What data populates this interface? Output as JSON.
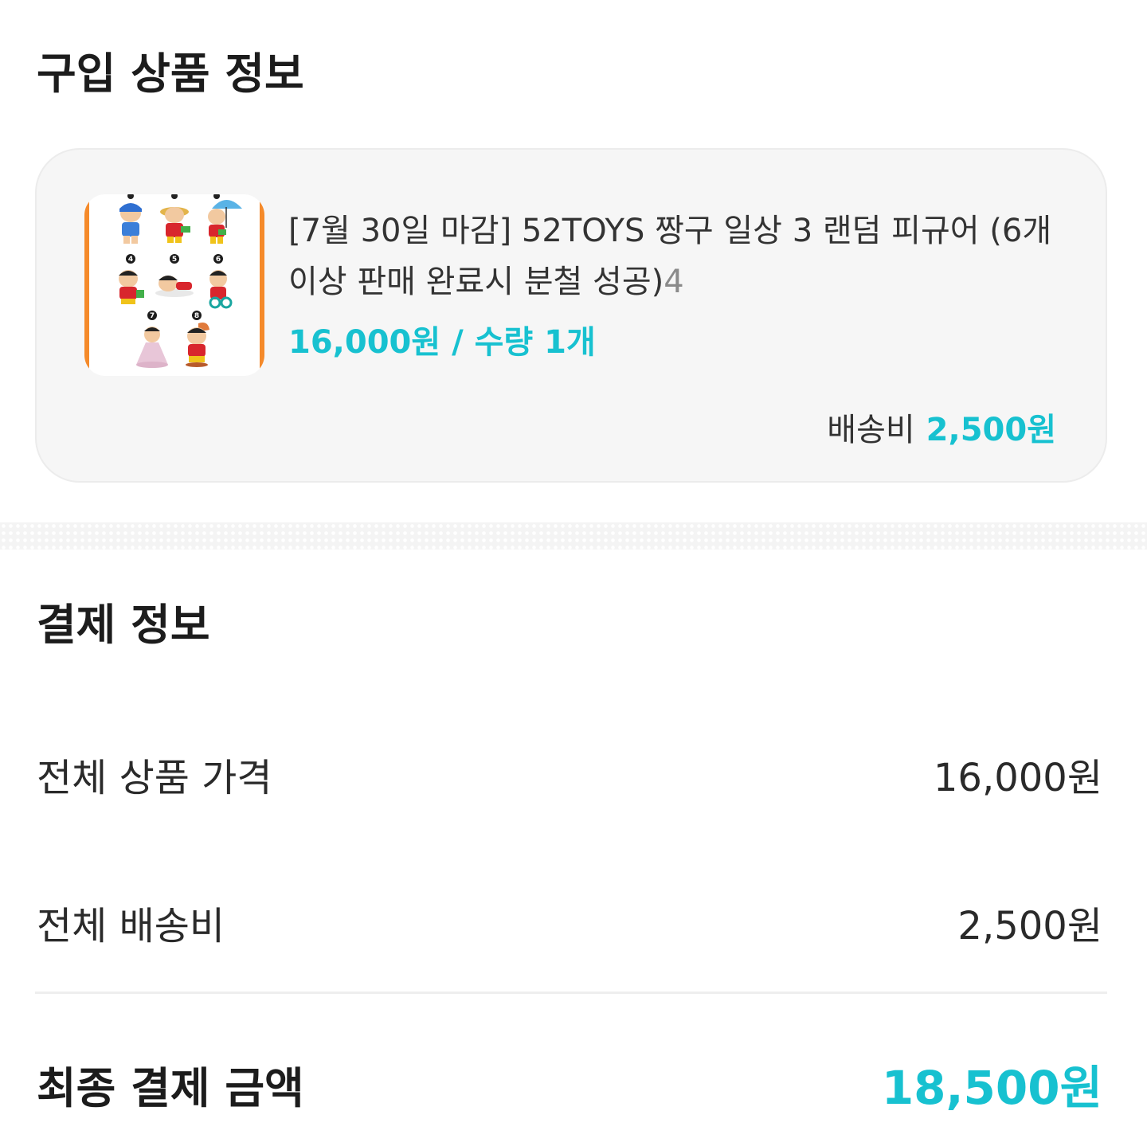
{
  "purchase_section": {
    "title": "구입 상품 정보"
  },
  "product": {
    "name": "[7월 30일 마감] 52TOYS 짱구 일상 3 랜덤 피규어 (6개 이상 판매 완료시 분철 성공)",
    "name_suffix": "4",
    "price_quantity": "16,000원 / 수량 1개",
    "shipping_label": "배송비",
    "shipping_value": "2,500원",
    "thumbnail_numbers": [
      "4",
      "5",
      "6",
      "7",
      "8"
    ],
    "thumbnail_frame_color": "#f58a2a"
  },
  "payment_section": {
    "title": "결제 정보",
    "rows": [
      {
        "label": "전체 상품 가격",
        "value": "16,000원"
      },
      {
        "label": "전체 배송비",
        "value": "2,500원"
      }
    ],
    "final_label": "최종 결제 금액",
    "final_value": "18,500원"
  },
  "colors": {
    "accent": "#17c1d0",
    "card_background": "#f6f6f6",
    "text_primary": "#1c1c1c"
  }
}
